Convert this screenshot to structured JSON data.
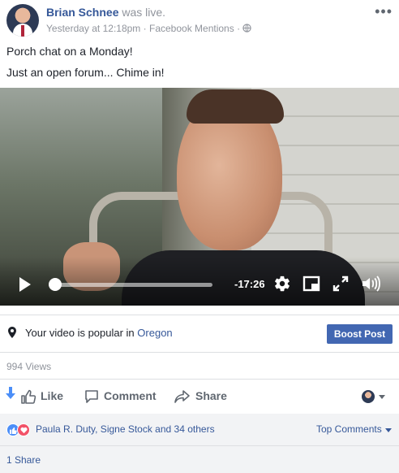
{
  "post": {
    "author": "Brian Schnee",
    "status": "was live.",
    "timestamp": "Yesterday at 12:18pm",
    "source": "Facebook Mentions",
    "separator": "·",
    "privacy_icon": "globe-icon",
    "menu_icon": "more-options-icon",
    "caption_line_1": "Porch chat on a Monday!",
    "caption_line_2": "Just an open forum... Chime in!"
  },
  "video": {
    "remaining_time": "-17:26",
    "progress": 0.0,
    "controls": [
      "play-icon",
      "settings-gear-icon",
      "pip-icon",
      "fullscreen-icon",
      "volume-icon"
    ]
  },
  "promo": {
    "text": "Your video is popular in",
    "location": "Oregon",
    "boost_label": "Boost Post",
    "icon": "map-pin-icon"
  },
  "stats": {
    "views": "994 Views"
  },
  "actions": {
    "like": "Like",
    "comment": "Comment",
    "share": "Share"
  },
  "reactions": {
    "summary": "Paula R. Duty, Signe Stock and 34 others",
    "sort_label": "Top Comments",
    "colors": {
      "like": "#4b8ef8",
      "love": "#f25268"
    }
  },
  "shares": {
    "count": "1 Share"
  },
  "colors": {
    "link": "#365899",
    "boost_button": "#4267b2",
    "meta_text": "#90949c"
  }
}
